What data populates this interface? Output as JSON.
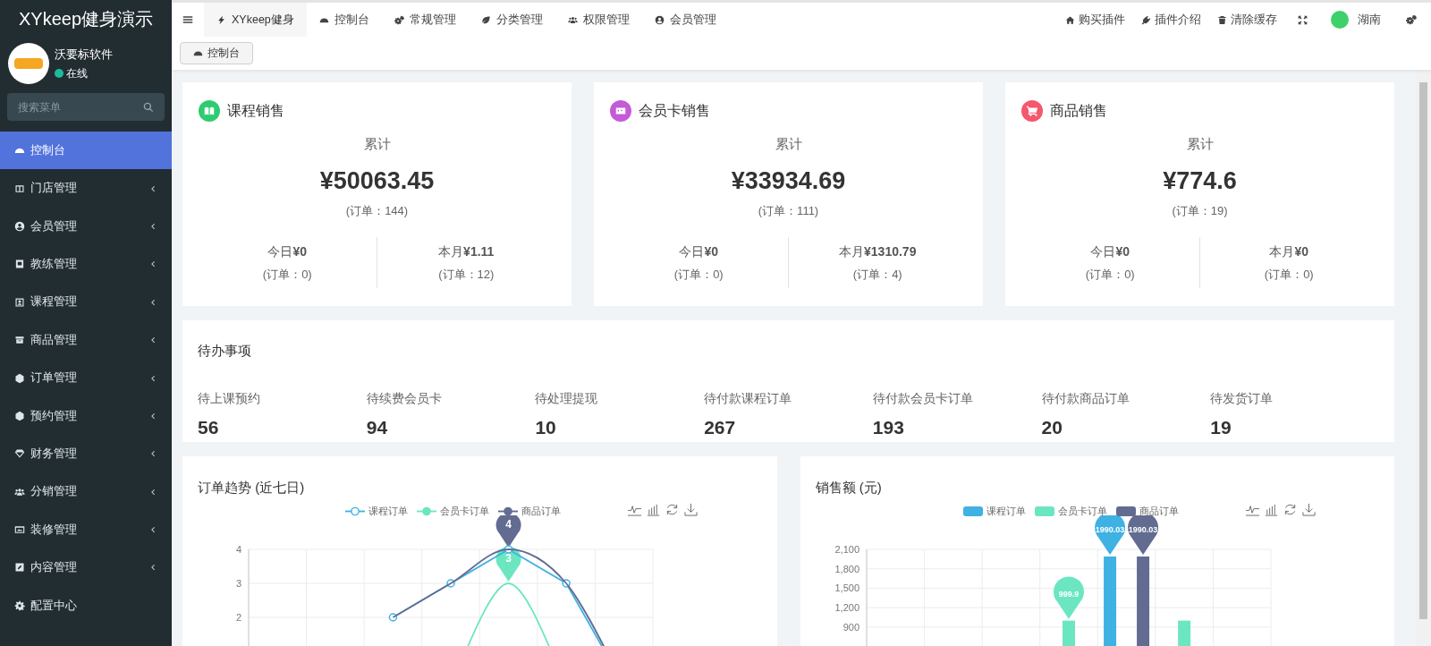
{
  "sidebar": {
    "title": "XYkeep健身演示",
    "user": {
      "name": "沃要标软件",
      "status": "在线",
      "online": true
    },
    "search": {
      "placeholder": "搜索菜单"
    },
    "items": [
      {
        "label": "控制台",
        "selected": true,
        "expandable": false
      },
      {
        "label": "门店管理",
        "selected": false,
        "expandable": true
      },
      {
        "label": "会员管理",
        "selected": false,
        "expandable": true
      },
      {
        "label": "教练管理",
        "selected": false,
        "expandable": true
      },
      {
        "label": "课程管理",
        "selected": false,
        "expandable": true
      },
      {
        "label": "商品管理",
        "selected": false,
        "expandable": true
      },
      {
        "label": "订单管理",
        "selected": false,
        "expandable": true
      },
      {
        "label": "预约管理",
        "selected": false,
        "expandable": true
      },
      {
        "label": "财务管理",
        "selected": false,
        "expandable": true
      },
      {
        "label": "分销管理",
        "selected": false,
        "expandable": true
      },
      {
        "label": "装修管理",
        "selected": false,
        "expandable": true
      },
      {
        "label": "内容管理",
        "selected": false,
        "expandable": true
      },
      {
        "label": "配置中心",
        "selected": false,
        "expandable": false
      }
    ]
  },
  "topbar": {
    "tabs": [
      {
        "label": "XYkeep健身",
        "selected": true
      },
      {
        "label": "控制台",
        "selected": false
      },
      {
        "label": "常规管理",
        "selected": false
      },
      {
        "label": "分类管理",
        "selected": false
      },
      {
        "label": "权限管理",
        "selected": false
      },
      {
        "label": "会员管理",
        "selected": false
      }
    ],
    "links": [
      {
        "label": "购买插件"
      },
      {
        "label": "插件介绍"
      },
      {
        "label": "清除缓存"
      }
    ],
    "user": "湖南"
  },
  "breadcrumb": {
    "tabs": [
      {
        "label": "控制台"
      }
    ]
  },
  "stats": [
    {
      "title": "课程销售",
      "color": "#2ecc71",
      "total_label": "累计",
      "amount": "¥50063.45",
      "orders": "(订单：144)",
      "today": "今日**¥0**",
      "today_orders": "(订单：0)",
      "month": "本月**¥1.11**",
      "month_orders": "(订单：12)"
    },
    {
      "title": "会员卡销售",
      "color": "#c45ad8",
      "total_label": "累计",
      "amount": "¥33934.69",
      "orders": "(订单：111)",
      "today": "今日**¥0**",
      "today_orders": "(订单：0)",
      "month": "本月**¥1310.79**",
      "month_orders": "(订单：4)"
    },
    {
      "title": "商品销售",
      "color": "#f5576c",
      "total_label": "累计",
      "amount": "¥774.6",
      "orders": "(订单：19)",
      "today": "今日**¥0**",
      "today_orders": "(订单：0)",
      "month": "本月**¥0**",
      "month_orders": "(订单：0)"
    }
  ],
  "todo": {
    "title": "待办事项",
    "items": [
      {
        "label": "待上课预约",
        "value": "56"
      },
      {
        "label": "待续费会员卡",
        "value": "94"
      },
      {
        "label": "待处理提现",
        "value": "10"
      },
      {
        "label": "待付款课程订单",
        "value": "267"
      },
      {
        "label": "待付款会员卡订单",
        "value": "193"
      },
      {
        "label": "待付款商品订单",
        "value": "20"
      },
      {
        "label": "待发货订单",
        "value": "19"
      }
    ]
  },
  "charts": [
    {
      "title": "订单趋势 (近七日)",
      "chart_data": {
        "type": "line",
        "legend": "top",
        "grid": true,
        "ylim": [
          0,
          4
        ],
        "yticks": [
          2,
          3,
          4
        ],
        "series": [
          {
            "name": "课程订单",
            "color": "#3fb1e3",
            "marker": "circle",
            "values": [
              null,
              null,
              2,
              3,
              4,
              3,
              0
            ]
          },
          {
            "name": "会员卡订单",
            "color": "#6be6c1",
            "values": [
              null,
              null,
              null,
              0,
              3,
              0,
              null
            ]
          },
          {
            "name": "商品订单",
            "color": "#626c91",
            "values": [
              null,
              null,
              2,
              3,
              4,
              3,
              0
            ]
          }
        ],
        "annotations": [
          "4",
          "3"
        ]
      }
    },
    {
      "title": "销售额 (元)",
      "chart_data": {
        "type": "bar",
        "legend": "top",
        "grid": true,
        "ylim": [
          0,
          2100
        ],
        "yticks": [
          {
            "value": 900,
            "label": "900"
          },
          {
            "value": 1200,
            "label": "1,200"
          },
          {
            "value": 1500,
            "label": "1,500"
          },
          {
            "value": 1800,
            "label": "1,800"
          },
          {
            "value": 2100,
            "label": "2,100"
          }
        ],
        "series": [
          {
            "name": "课程订单",
            "color": "#3fb1e3",
            "values": [
              0,
              0,
              0,
              0,
              1990.03,
              0,
              0
            ]
          },
          {
            "name": "会员卡订单",
            "color": "#6be6c1",
            "values": [
              0,
              0,
              0,
              999.9,
              0,
              999.9,
              0
            ]
          },
          {
            "name": "商品订单",
            "color": "#626c91",
            "values": [
              0,
              0,
              0,
              0,
              1990.03,
              0,
              0
            ]
          }
        ],
        "annotations": [
          "999.9",
          "1990.03",
          "1990.03"
        ]
      }
    }
  ]
}
